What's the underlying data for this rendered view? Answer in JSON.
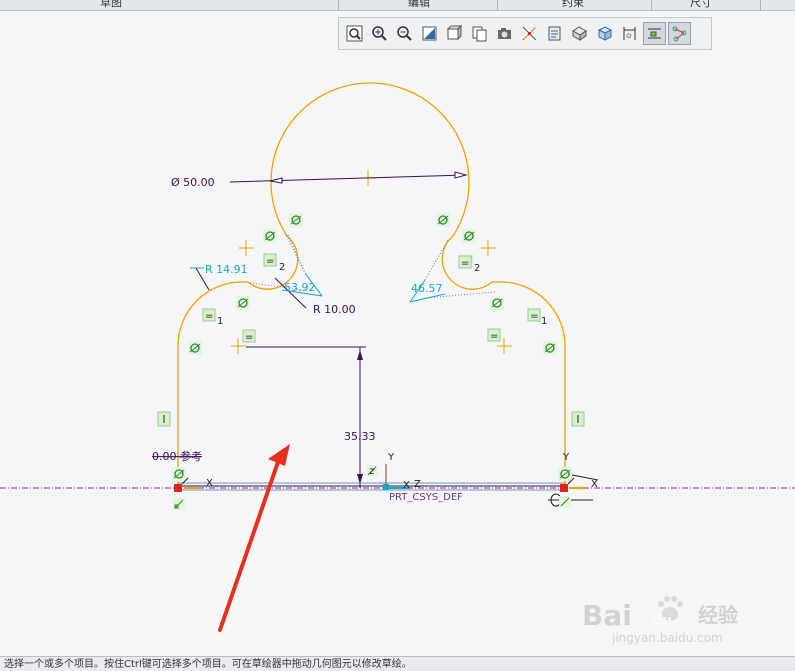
{
  "window": {
    "top_tabs": [
      "草图",
      "编辑",
      "约束",
      "尺寸"
    ]
  },
  "toolbar": {
    "buttons": [
      {
        "name": "refit-icon"
      },
      {
        "name": "zoom-in-icon"
      },
      {
        "name": "zoom-out-icon"
      },
      {
        "name": "repaint-icon"
      },
      {
        "name": "display-style-icon"
      },
      {
        "name": "saved-views-icon"
      },
      {
        "name": "view-manager-icon"
      },
      {
        "name": "datum-display-icon"
      },
      {
        "name": "annotation-display-icon"
      },
      {
        "name": "spin-center-icon"
      },
      {
        "name": "sketch-view-icon"
      },
      {
        "name": "sketcher-display-icon"
      },
      {
        "name": "constraint-display-icon"
      },
      {
        "name": "vertex-display-icon"
      }
    ]
  },
  "sketch": {
    "dimensions": {
      "diameter": "Ø 50.00",
      "radius_left": "R 14.91",
      "radius_inner": "R 10.00",
      "angle_left": "53.92",
      "angle_right": "46.57",
      "height": "35.33",
      "reference": "0.00 参考"
    },
    "constraint_labels": {
      "left_2": "2",
      "right_2": "2",
      "left_1": "1",
      "right_1": "1",
      "equal": "="
    },
    "csys": {
      "name": "PRT_CSYS_DEF",
      "x": "X",
      "y": "Y",
      "z": "Z"
    },
    "colors": {
      "geometry": "#f0a000",
      "dimension": "#3a1050",
      "angle": "#18a8c0",
      "centerline": "#a020a0",
      "constraint_green": "#2a8a2a"
    }
  },
  "statusbar": {
    "text": "选择一个或多个项目。按住Ctrl键可选择多个项目。可在草绘器中拖动几何图元以修改草绘。"
  },
  "watermark": {
    "brand": "Bai",
    "paw": "du",
    "cn": "经验",
    "url": "jingyan.baidu.com"
  }
}
